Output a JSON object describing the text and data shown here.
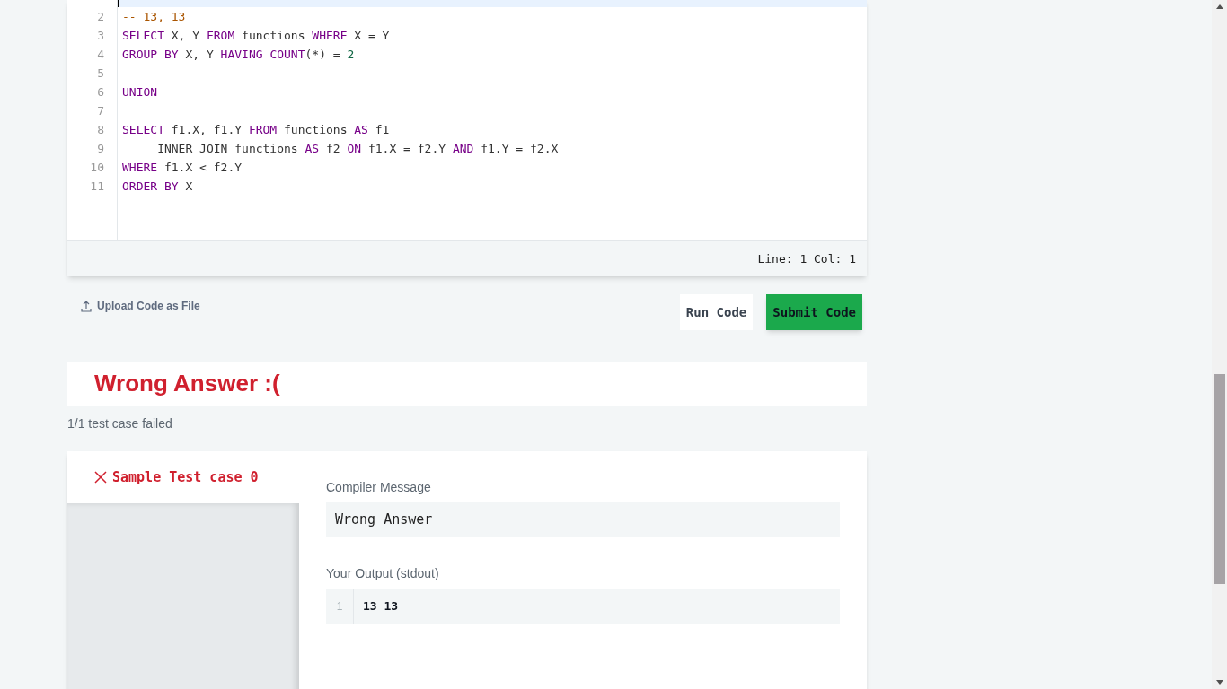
{
  "editor": {
    "lines": [
      {
        "number": "2",
        "tokens": [
          {
            "kind": "comment",
            "text": "-- 13, 13"
          }
        ]
      },
      {
        "number": "3",
        "tokens": [
          {
            "kind": "keyword",
            "text": "SELECT"
          },
          {
            "kind": "plain",
            "text": " X, Y "
          },
          {
            "kind": "keyword",
            "text": "FROM"
          },
          {
            "kind": "plain",
            "text": " functions "
          },
          {
            "kind": "keyword",
            "text": "WHERE"
          },
          {
            "kind": "plain",
            "text": " X = Y"
          }
        ]
      },
      {
        "number": "4",
        "tokens": [
          {
            "kind": "keyword",
            "text": "GROUP BY"
          },
          {
            "kind": "plain",
            "text": " X, Y "
          },
          {
            "kind": "keyword",
            "text": "HAVING COUNT"
          },
          {
            "kind": "plain",
            "text": "(*) = "
          },
          {
            "kind": "number",
            "text": "2"
          }
        ]
      },
      {
        "number": "5"
      },
      {
        "number": "6",
        "tokens": [
          {
            "kind": "keyword",
            "text": "UNION"
          }
        ]
      },
      {
        "number": "7"
      },
      {
        "number": "8",
        "tokens": [
          {
            "kind": "keyword",
            "text": "SELECT"
          },
          {
            "kind": "plain",
            "text": " f1.X, f1.Y "
          },
          {
            "kind": "keyword",
            "text": "FROM"
          },
          {
            "kind": "plain",
            "text": " functions "
          },
          {
            "kind": "keyword",
            "text": "AS"
          },
          {
            "kind": "plain",
            "text": " f1"
          }
        ]
      },
      {
        "number": "9",
        "tokens": [
          {
            "kind": "plain",
            "text": "     INNER JOIN functions "
          },
          {
            "kind": "keyword",
            "text": "AS"
          },
          {
            "kind": "plain",
            "text": " f2 "
          },
          {
            "kind": "keyword",
            "text": "ON"
          },
          {
            "kind": "plain",
            "text": " f1.X = f2.Y "
          },
          {
            "kind": "keyword",
            "text": "AND"
          },
          {
            "kind": "plain",
            "text": " f1.Y = f2.X"
          }
        ]
      },
      {
        "number": "10",
        "tokens": [
          {
            "kind": "keyword",
            "text": "WHERE"
          },
          {
            "kind": "plain",
            "text": " f1.X < f2.Y"
          }
        ]
      },
      {
        "number": "11",
        "tokens": [
          {
            "kind": "keyword",
            "text": "ORDER BY"
          },
          {
            "kind": "plain",
            "text": " X"
          }
        ]
      }
    ],
    "status": "Line: 1 Col: 1"
  },
  "upload_link": "Upload Code as File",
  "buttons": [
    {
      "label": "Run Code",
      "kind": "secondary"
    },
    {
      "label": "Submit Code",
      "kind": "primary"
    }
  ],
  "result": {
    "title": "Wrong Answer :(",
    "summary": "1/1 test case failed"
  },
  "test_case": {
    "tab": {
      "label": "Sample Test case 0",
      "passed": false
    },
    "compiler_message_label": "Compiler Message",
    "compiler_message": "Wrong Answer",
    "output_label": "Your Output (stdout)",
    "output_lines": [
      {
        "number": "1",
        "text": "13 13"
      }
    ]
  }
}
